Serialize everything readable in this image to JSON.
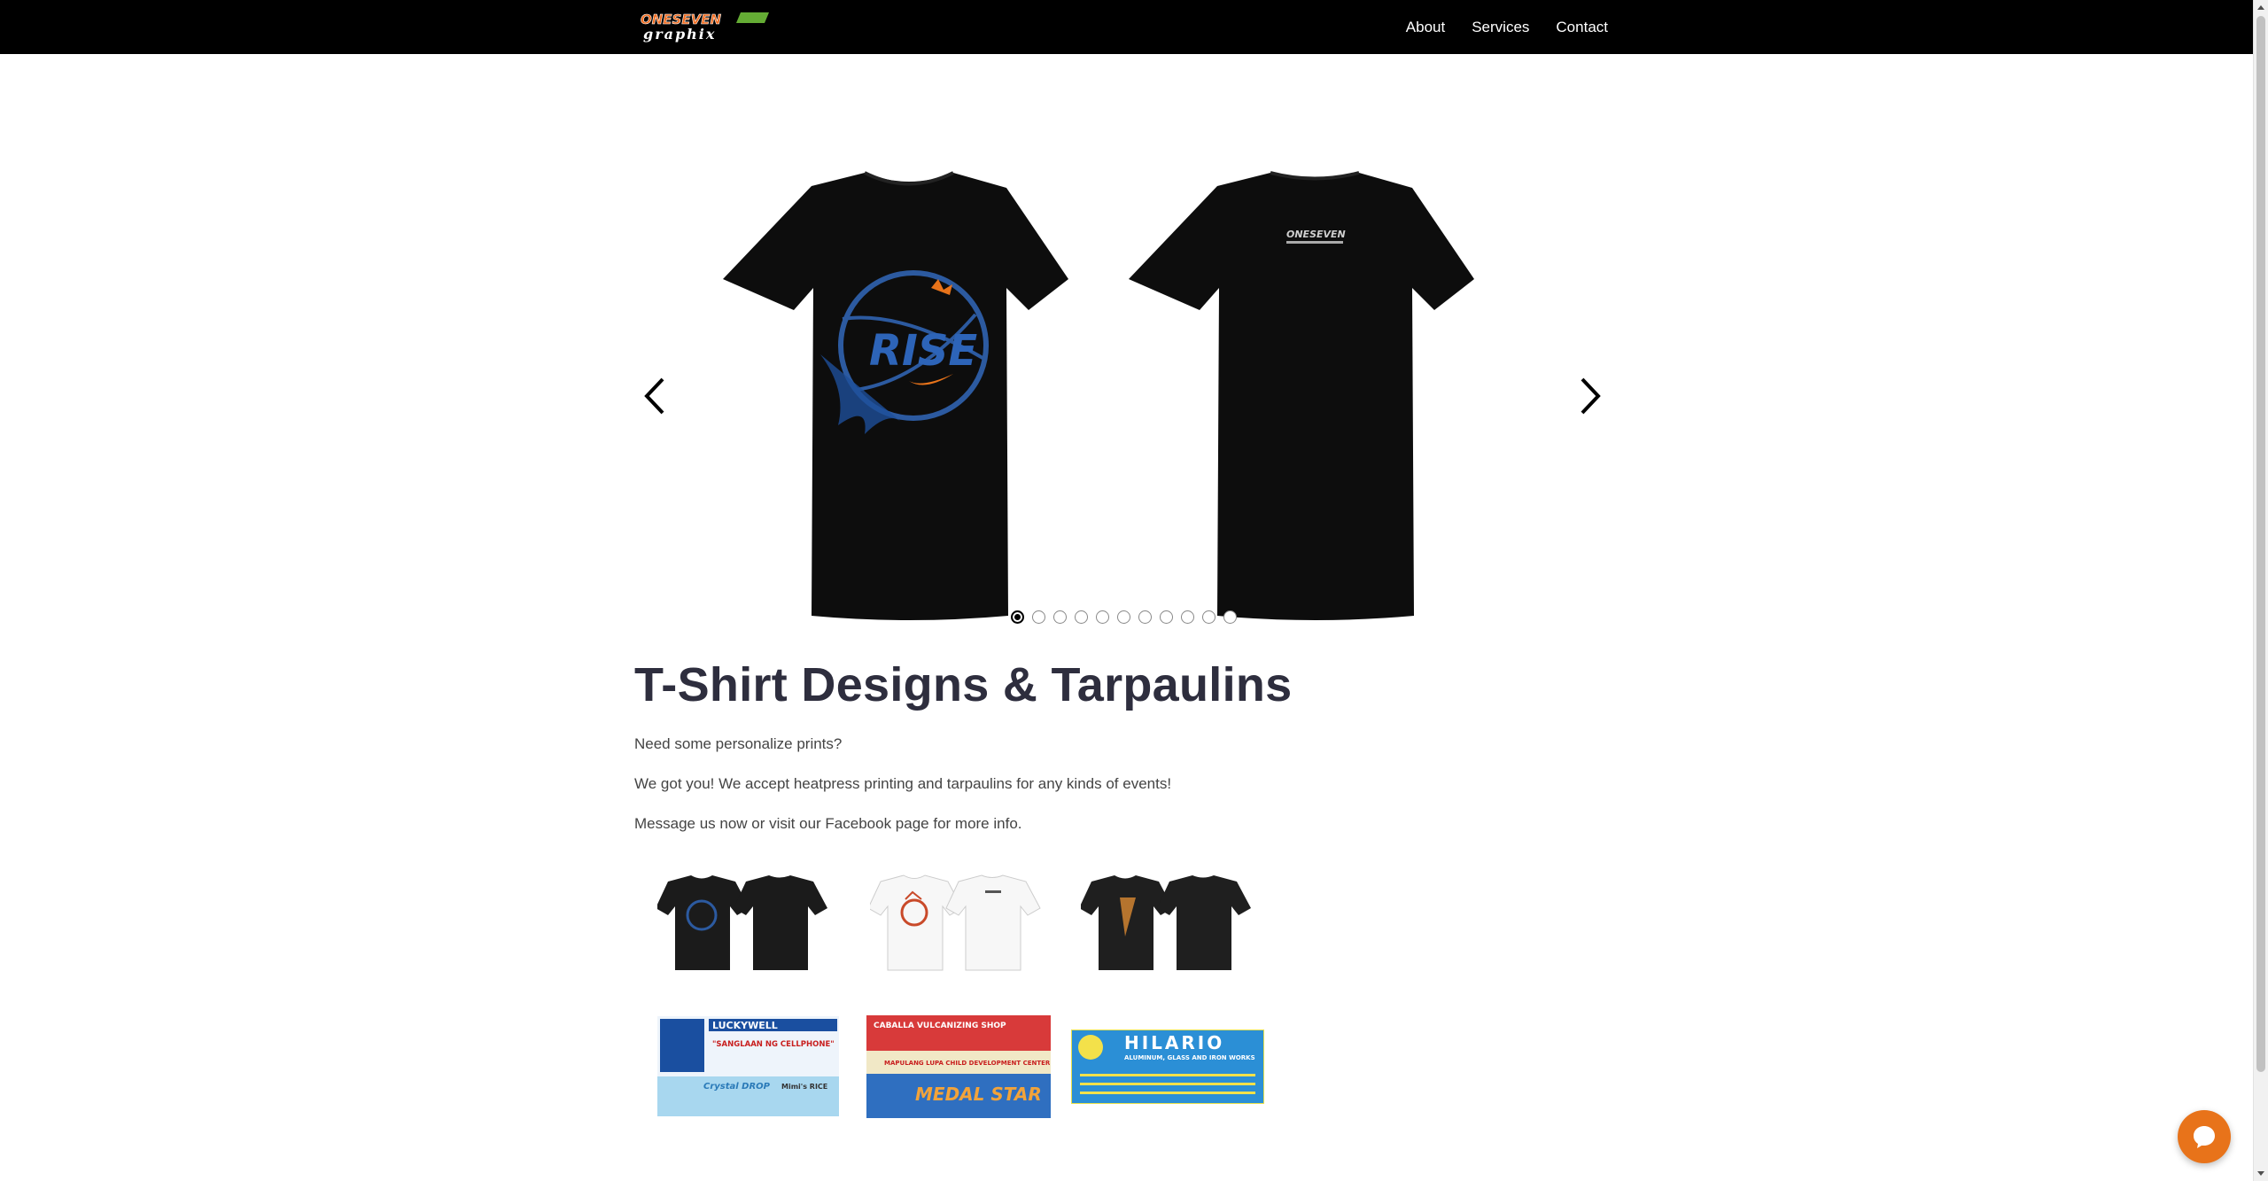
{
  "nav": {
    "logo_text_top": "ONESEVEN",
    "logo_text_bottom": "graphix",
    "links": [
      "About",
      "Services",
      "Contact"
    ]
  },
  "carousel": {
    "total_slides": 11,
    "active_index": 0,
    "slide_graphic_text": "RISE",
    "back_logo_text": "ONESEVEN"
  },
  "section": {
    "title": "T-Shirt Designs & Tarpaulins",
    "paragraphs": [
      "Need some personalize prints?",
      "We got you! We accept heatpress printing and tarpaulins for any kinds of events!",
      "Message us now or visit our Facebook page for more info."
    ]
  },
  "tarpaulins": [
    {
      "headline": "LUCKYWELL",
      "sub": "\"SANGLAAN NG CELLPHONE\"",
      "extra": "Crystal DROP",
      "extra2": "Mimi's RICE"
    },
    {
      "headline": "CABALLA VULCANIZING SHOP",
      "sub": "MAPULANG LUPA CHILD DEVELOPMENT CENTER",
      "extra": "MEDAL STAR"
    },
    {
      "headline": "HILARIO",
      "sub": "ALUMINUM, GLASS AND IRON WORKS"
    }
  ],
  "colors": {
    "navbar_bg": "#000000",
    "chat_button": "#e8731a",
    "title": "#2e2e3e"
  }
}
